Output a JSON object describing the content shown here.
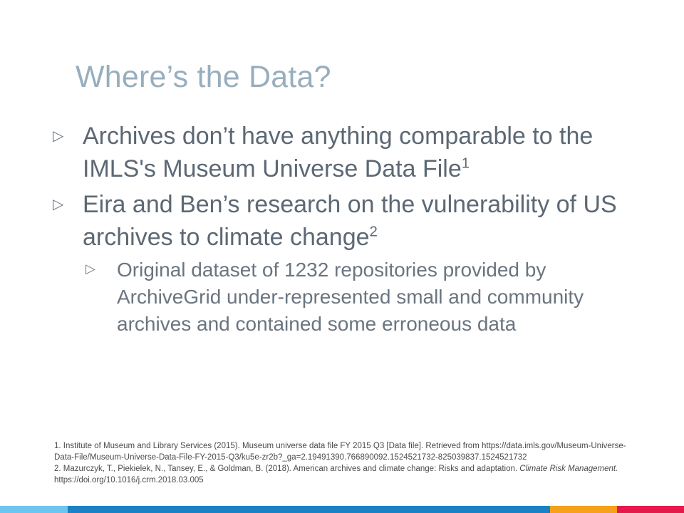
{
  "slide": {
    "title": "Where’s the Data?",
    "bullets": [
      {
        "text": "Archives don’t have anything comparable to the IMLS's Museum Universe Data File",
        "sup": "1"
      },
      {
        "text": "Eira and Ben’s research on the vulnerability of US archives to climate change",
        "sup": "2",
        "sub": "Original dataset of 1232 repositories provided by ArchiveGrid under-represented small and community archives and contained some erroneous data"
      }
    ],
    "bullet_icon": "triangle-right-outline-icon",
    "references": {
      "ref1": "1. Institute of Museum and Library Services (2015). Museum universe data file FY 2015 Q3 [Data file]. Retrieved from https://data.imls.gov/Museum-Universe-Data-File/Museum-Universe-Data-File-FY-2015-Q3/ku5e-zr2b?_ga=2.19491390.766890092.1524521732-825039837.1524521732",
      "ref2_a": "2. Mazurczyk, T., Piekielek, N., Tansey, E., & Goldman, B. (2018). American archives and climate change: Risks and adaptation. ",
      "ref2_journal": "Climate Risk Management.",
      "ref2_b": " https://doi.org/10.1016/j.crm.2018.03.005"
    },
    "footer_colors": [
      "#6cc4ef",
      "#1a81c4",
      "#f5a11b",
      "#e5194c"
    ]
  }
}
